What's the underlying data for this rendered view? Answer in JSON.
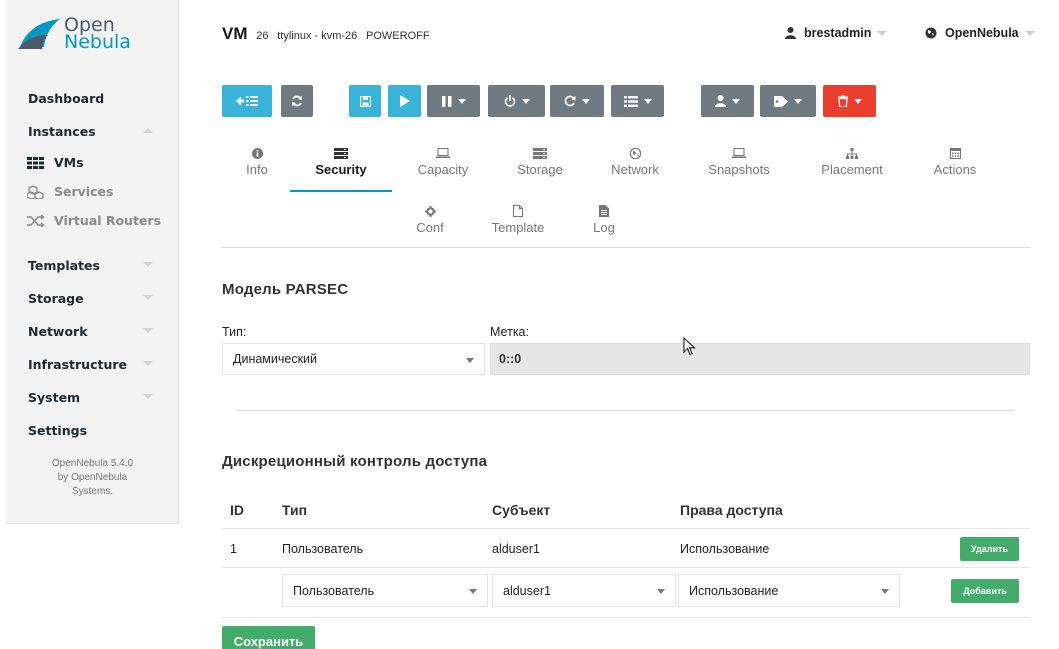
{
  "brand": {
    "line1": "Open",
    "line2": "Nebula"
  },
  "sidebar": {
    "items": [
      {
        "label": "Dashboard"
      },
      {
        "label": "Instances"
      },
      {
        "label": "VMs"
      },
      {
        "label": "Services"
      },
      {
        "label": "Virtual Routers"
      },
      {
        "label": "Templates"
      },
      {
        "label": "Storage"
      },
      {
        "label": "Network"
      },
      {
        "label": "Infrastructure"
      },
      {
        "label": "System"
      },
      {
        "label": "Settings"
      }
    ],
    "footer_line1": "OpenNebula 5.4.0",
    "footer_line2": "by OpenNebula",
    "footer_line3": "Systems."
  },
  "header": {
    "title": "VM",
    "vm_id": "26",
    "vm_name": "ttylinux - kvm-26",
    "vm_state": "POWEROFF",
    "user": "brestadmin",
    "zone": "OpenNebula"
  },
  "tabs": {
    "info": "Info",
    "security": "Security",
    "capacity": "Capacity",
    "storage": "Storage",
    "network": "Network",
    "snapshots": "Snapshots",
    "placement": "Placement",
    "actions": "Actions",
    "conf": "Conf",
    "template": "Template",
    "log": "Log"
  },
  "parsec": {
    "title": "Модель PARSEC",
    "type_label": "Тип:",
    "type_value": "Динамический",
    "mark_label": "Метка:",
    "mark_value": "0::0"
  },
  "acl": {
    "title": "Дискреционный контроль доступа",
    "columns": [
      "ID",
      "Тип",
      "Субъект",
      "Права доступа"
    ],
    "rows": [
      {
        "id": "1",
        "type": "Пользователь",
        "subject": "alduser1",
        "rights": "Использование",
        "action": "Удалить"
      }
    ],
    "new_row": {
      "type": "Пользователь",
      "subject": "alduser1",
      "rights": "Использование",
      "action": "Добавить"
    },
    "save": "Сохранить"
  },
  "colors": {
    "accent": "#0098c3",
    "toolbar_blue": "#39b3d7",
    "toolbar_gray": "#6f7a82",
    "toolbar_red": "#ea3f2f",
    "green": "#43ac6a"
  }
}
